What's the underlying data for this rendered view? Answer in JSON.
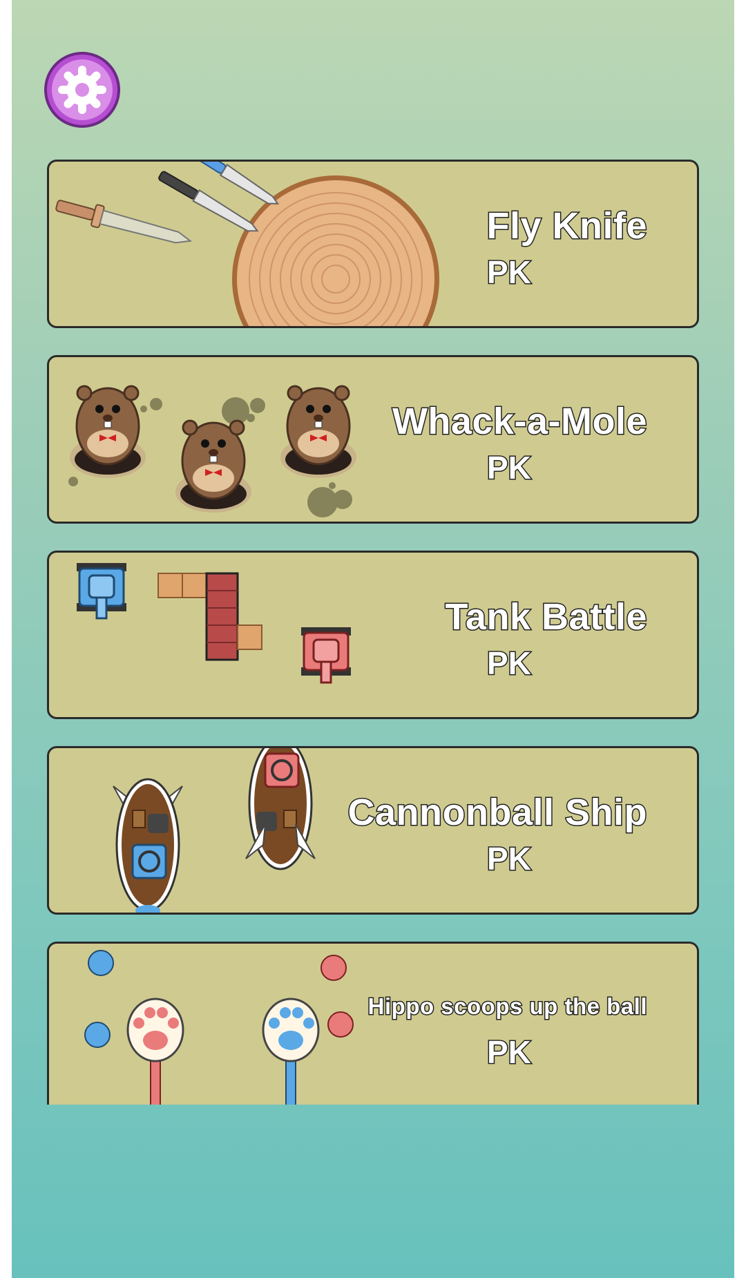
{
  "settings": {
    "icon": "gear-icon",
    "color": "#b64ed2"
  },
  "games": [
    {
      "title": "Fly Knife",
      "mode": "PK"
    },
    {
      "title": "Whack-a-Mole",
      "mode": "PK"
    },
    {
      "title": "Tank Battle",
      "mode": "PK"
    },
    {
      "title": "Cannonball Ship",
      "mode": "PK"
    },
    {
      "title": "Hippo scoops up the ball",
      "mode": "PK"
    }
  ],
  "colors": {
    "card": "#cfcb90",
    "blue_team": "#5aa8e6",
    "red_team": "#ea7b7b"
  }
}
